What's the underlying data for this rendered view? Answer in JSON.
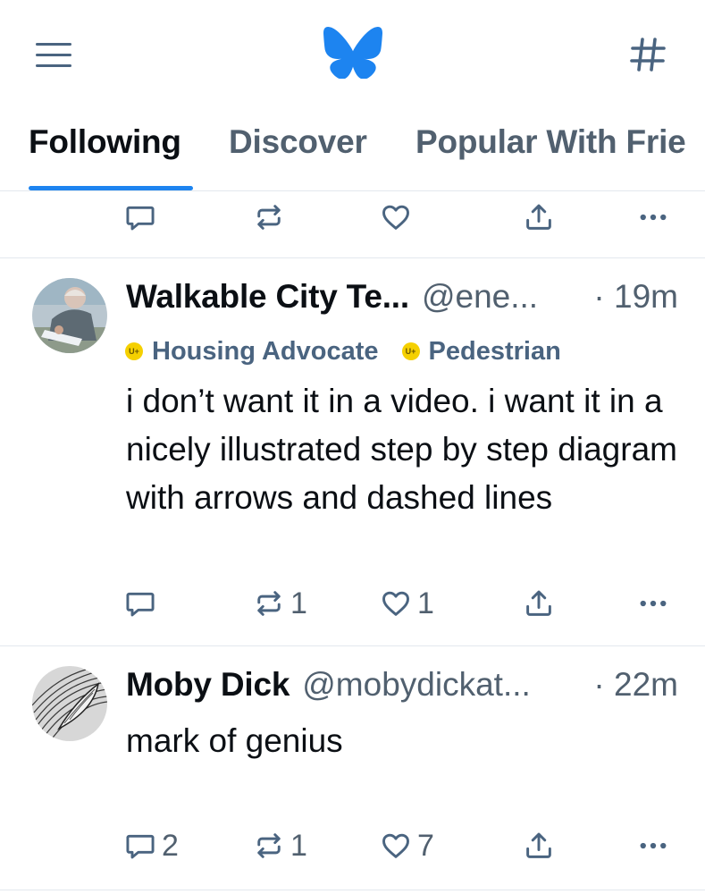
{
  "tabs": [
    {
      "label": "Following"
    },
    {
      "label": "Discover"
    },
    {
      "label": "Popular With Frie"
    }
  ],
  "posts": [
    {
      "author": "Walkable City Te...",
      "handle": "@ene...",
      "time": "· 19m",
      "labels": [
        {
          "badge": "U+",
          "text": "Housing Advocate"
        },
        {
          "badge": "U+",
          "text": "Pedestrian"
        }
      ],
      "text": "i don’t want it in a video. i want it in a nicely illustrated step by step diagram with arrows and dashed lines",
      "replies": "",
      "reposts": "1",
      "likes": "1"
    },
    {
      "author": "Moby Dick",
      "handle": "@mobydickat...",
      "time": "· 22m",
      "text": "mark of genius",
      "replies": "2",
      "reposts": "1",
      "likes": "7"
    }
  ],
  "icons": {
    "menu": "hamburger-menu-icon",
    "logo": "butterfly-logo-icon",
    "feeds": "hashtag-icon",
    "reply": "speech-bubble-icon",
    "repost": "repost-arrows-icon",
    "like": "heart-icon",
    "share": "share-upload-icon",
    "more": "ellipsis-icon"
  },
  "colors": {
    "accent": "#1d84f0",
    "muted": "#51606f",
    "icon": "#4a6480",
    "label_badge": "#f5d000",
    "text": "#0b0f14",
    "divider": "#e3e8ee"
  }
}
